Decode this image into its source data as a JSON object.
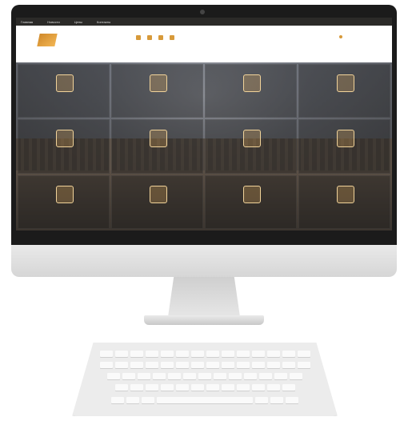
{
  "site": {
    "topbar": {
      "links": [
        "Главная",
        "Новости",
        "Цены",
        "Контакты"
      ],
      "right_text": ""
    },
    "header": {
      "logo_text": "",
      "phone_text": "",
      "nav": [
        "",
        "",
        ""
      ]
    },
    "tiles": [
      {
        "icon": "puzzle-icon",
        "text": ""
      },
      {
        "icon": "people-icon",
        "text": ""
      },
      {
        "icon": "network-icon",
        "text": ""
      },
      {
        "icon": "grid-icon",
        "text": ""
      },
      {
        "icon": "building-icon",
        "text": ""
      },
      {
        "icon": "tower-icon",
        "text": ""
      },
      {
        "icon": "temple-icon",
        "text": ""
      },
      {
        "icon": "award-icon",
        "text": ""
      },
      {
        "icon": "book-icon",
        "text": ""
      },
      {
        "icon": "gear-icon",
        "text": ""
      },
      {
        "icon": "tree-icon",
        "text": ""
      },
      {
        "icon": "chart-icon",
        "text": ""
      }
    ]
  }
}
